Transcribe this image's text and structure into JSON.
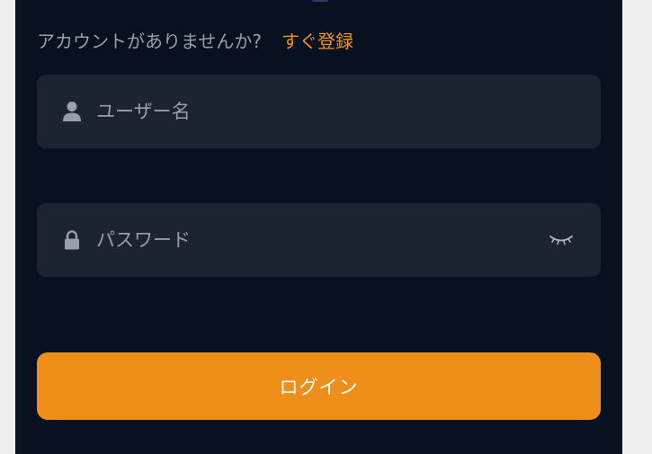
{
  "signup": {
    "question": "アカウントがありませんか?",
    "link_label": "すぐ登録"
  },
  "username": {
    "placeholder": "ユーザー名",
    "value": "",
    "icon": "user-icon"
  },
  "password": {
    "placeholder": "パスワード",
    "value": "",
    "icon": "lock-icon",
    "toggle_icon": "eye-closed-icon"
  },
  "login_button": {
    "label": "ログイン"
  },
  "colors": {
    "panel_background": "#081120",
    "page_background": "#eeeeee",
    "field_background": "#1c2331",
    "accent": "#f08e1a",
    "muted_text": "#9a9ea8",
    "button_text": "#ffffff"
  }
}
